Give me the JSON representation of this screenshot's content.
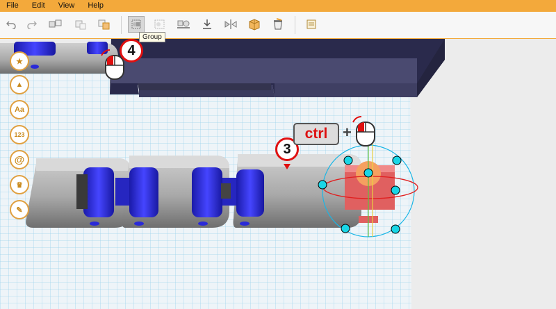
{
  "menu": [
    "File",
    "Edit",
    "View",
    "Help"
  ],
  "toolbar": {
    "buttons": [
      {
        "name": "undo-icon"
      },
      {
        "name": "redo-icon"
      },
      {
        "name": "copy-icon"
      },
      {
        "name": "paste-icon"
      },
      {
        "name": "duplicate-icon"
      },
      {
        "name": "group-icon"
      },
      {
        "name": "ungroup-icon"
      },
      {
        "name": "align-icon"
      },
      {
        "name": "drop-icon"
      },
      {
        "name": "mirror-icon"
      },
      {
        "name": "box-icon"
      },
      {
        "name": "delete-icon"
      },
      {
        "name": "notes-icon"
      }
    ],
    "tooltip": "Group"
  },
  "callouts": {
    "step3": "3",
    "step4": "4",
    "ctrl": "ctrl",
    "plus": "+"
  },
  "sidebar": [
    "star-icon",
    "shape-icon",
    "text-icon",
    "numbers-icon",
    "at-icon",
    "crown-icon",
    "tools-icon"
  ],
  "sidebar_labels": {
    "text": "Aa",
    "numbers": "123",
    "at": "@"
  },
  "colors": {
    "menubar": "#f3a93b",
    "accent_blue": "#2f2fd8",
    "link_gray": "#b8b8b8",
    "selected_red": "#e06060",
    "gizmo_cyan": "#19d6e6"
  }
}
